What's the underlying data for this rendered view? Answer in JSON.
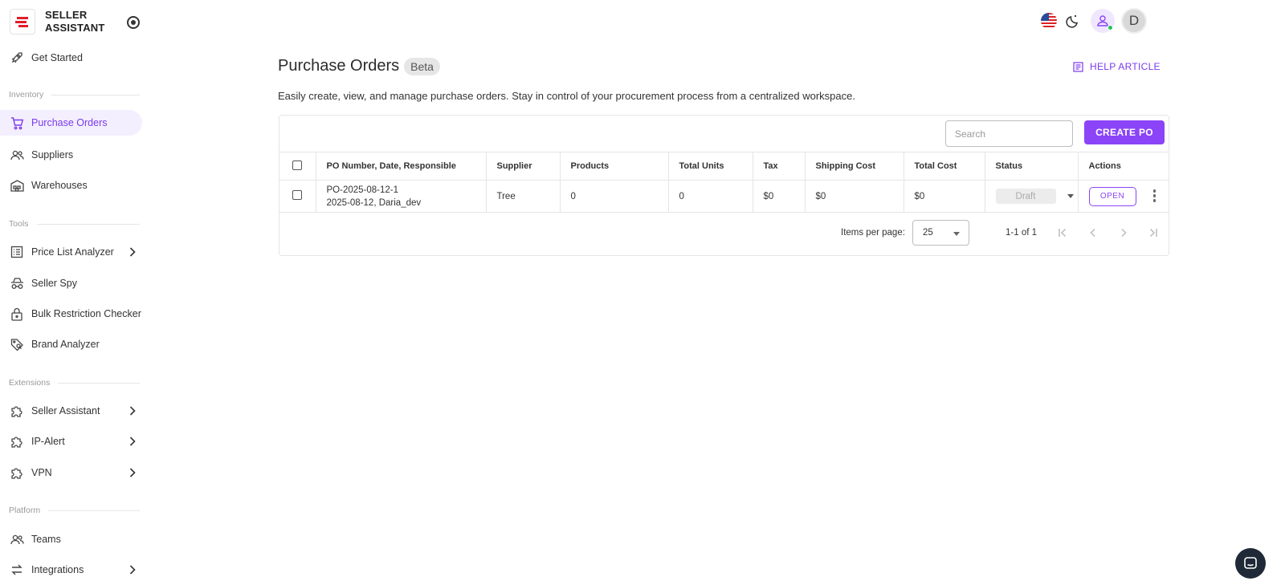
{
  "brand": {
    "line1": "SELLER",
    "line2": "ASSISTANT"
  },
  "sidebar": {
    "get_started": "Get Started",
    "sections": {
      "inventory": "Inventory",
      "tools": "Tools",
      "extensions": "Extensions",
      "platform": "Platform"
    },
    "items": {
      "purchase_orders": "Purchase Orders",
      "suppliers": "Suppliers",
      "warehouses": "Warehouses",
      "price_list_analyzer": "Price List Analyzer",
      "seller_spy": "Seller Spy",
      "bulk_restriction_checker": "Bulk Restriction Checker",
      "brand_analyzer": "Brand Analyzer",
      "seller_assistant": "Seller Assistant",
      "ip_alert": "IP-Alert",
      "vpn": "VPN",
      "teams": "Teams",
      "integrations": "Integrations"
    }
  },
  "topbar": {
    "avatar_letter": "D"
  },
  "page": {
    "title": "Purchase Orders",
    "badge": "Beta",
    "help_label": "HELP ARTICLE",
    "subtitle": "Easily create, view, and manage purchase orders. Stay in control of your procurement process from a centralized workspace."
  },
  "toolbar": {
    "search_placeholder": "Search",
    "create_label": "CREATE PO"
  },
  "table": {
    "headers": {
      "po": "PO Number, Date, Responsible",
      "supplier": "Supplier",
      "products": "Products",
      "units": "Total Units",
      "tax": "Tax",
      "shipping": "Shipping Cost",
      "total": "Total Cost",
      "status": "Status",
      "actions": "Actions"
    },
    "rows": [
      {
        "po_number": "PO-2025-08-12-1",
        "po_meta": "2025-08-12, Daria_dev",
        "supplier": "Tree",
        "products": "0",
        "units": "0",
        "tax": "$0",
        "shipping": "$0",
        "total": "$0",
        "status": "Draft",
        "action": "OPEN"
      }
    ]
  },
  "pager": {
    "items_label": "Items per page:",
    "per_page": "25",
    "range": "1-1 of 1"
  },
  "colors": {
    "accent": "#8b44f7",
    "brand_red": "#e11d2a"
  }
}
